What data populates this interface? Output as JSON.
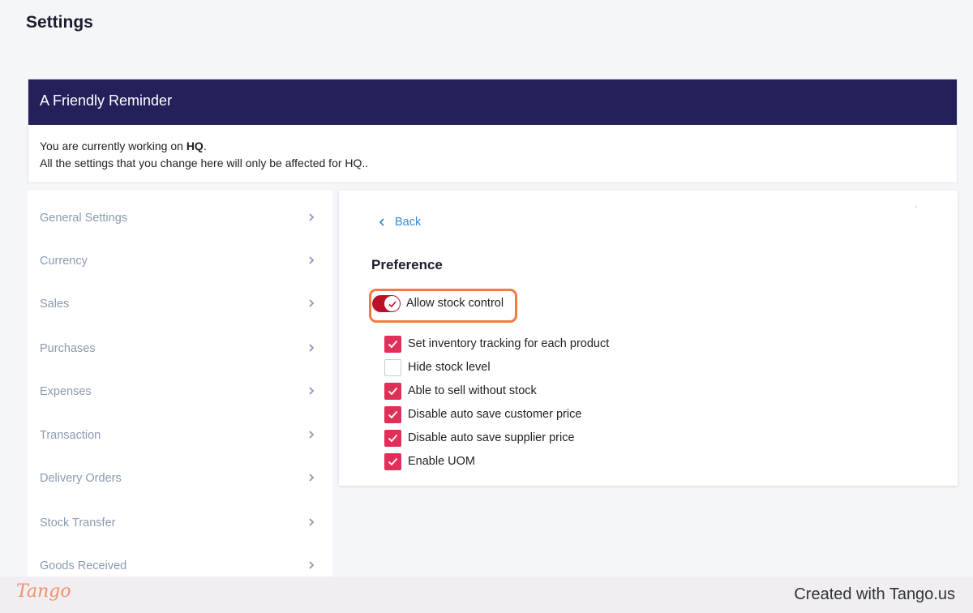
{
  "page": {
    "title": "Settings"
  },
  "reminder": {
    "title": "A Friendly Reminder",
    "line1_prefix": "You are currently working on ",
    "line1_branch": "HQ",
    "line1_suffix": ".",
    "line2": "All the settings that you change here will only be affected for HQ.."
  },
  "sidebar": {
    "items": [
      {
        "label": "General Settings"
      },
      {
        "label": "Currency"
      },
      {
        "label": "Sales"
      },
      {
        "label": "Purchases"
      },
      {
        "label": "Expenses"
      },
      {
        "label": "Transaction"
      },
      {
        "label": "Delivery Orders"
      },
      {
        "label": "Stock Transfer"
      },
      {
        "label": "Goods Received"
      }
    ],
    "chevron_icon": "chevron-right-icon"
  },
  "panel": {
    "back_label": "Back",
    "section_title": "Preference",
    "toggle": {
      "label": "Allow stock control",
      "on": true
    },
    "options": [
      {
        "label": "Set inventory tracking for each product",
        "checked": true
      },
      {
        "label": "Hide stock level",
        "checked": false
      },
      {
        "label": "Able to sell without stock",
        "checked": true
      },
      {
        "label": "Disable auto save customer price",
        "checked": true
      },
      {
        "label": "Disable auto save supplier price",
        "checked": true
      },
      {
        "label": "Enable UOM",
        "checked": true
      }
    ]
  },
  "footer": {
    "logo_text": "Tango",
    "created_with": "Created with Tango.us"
  },
  "colors": {
    "header_navy": "#23205a",
    "checkbox_pink": "#e0305a",
    "toggle_red": "#bb1026",
    "highlight_orange": "#f47a42",
    "link_blue": "#3a8ad6",
    "sidebar_text": "#8a9ab0"
  }
}
